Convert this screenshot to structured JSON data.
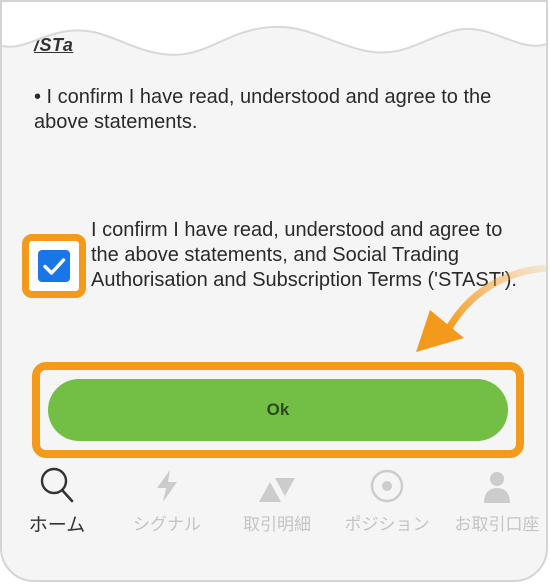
{
  "partial_link": "/STa",
  "statement": "• I confirm I have read, understood and agree to the above statements.",
  "agreement": {
    "checked": true,
    "text": "I confirm I have read, understood and agree to the above statements, and Social Trading Authorisation and Subscription Terms ('STAST')."
  },
  "ok_button": {
    "label": "Ok",
    "color": "#73bf45"
  },
  "highlight_color": "#f39a1c",
  "checkbox_color": "#1976e8",
  "tabs": [
    {
      "label": "ホーム",
      "icon": "search-icon",
      "active": true
    },
    {
      "label": "シグナル",
      "icon": "lightning-icon",
      "active": false
    },
    {
      "label": "取引明細",
      "icon": "triangles-icon",
      "active": false
    },
    {
      "label": "ポジション",
      "icon": "target-icon",
      "active": false
    },
    {
      "label": "お取引口座",
      "icon": "person-icon",
      "active": false
    }
  ]
}
